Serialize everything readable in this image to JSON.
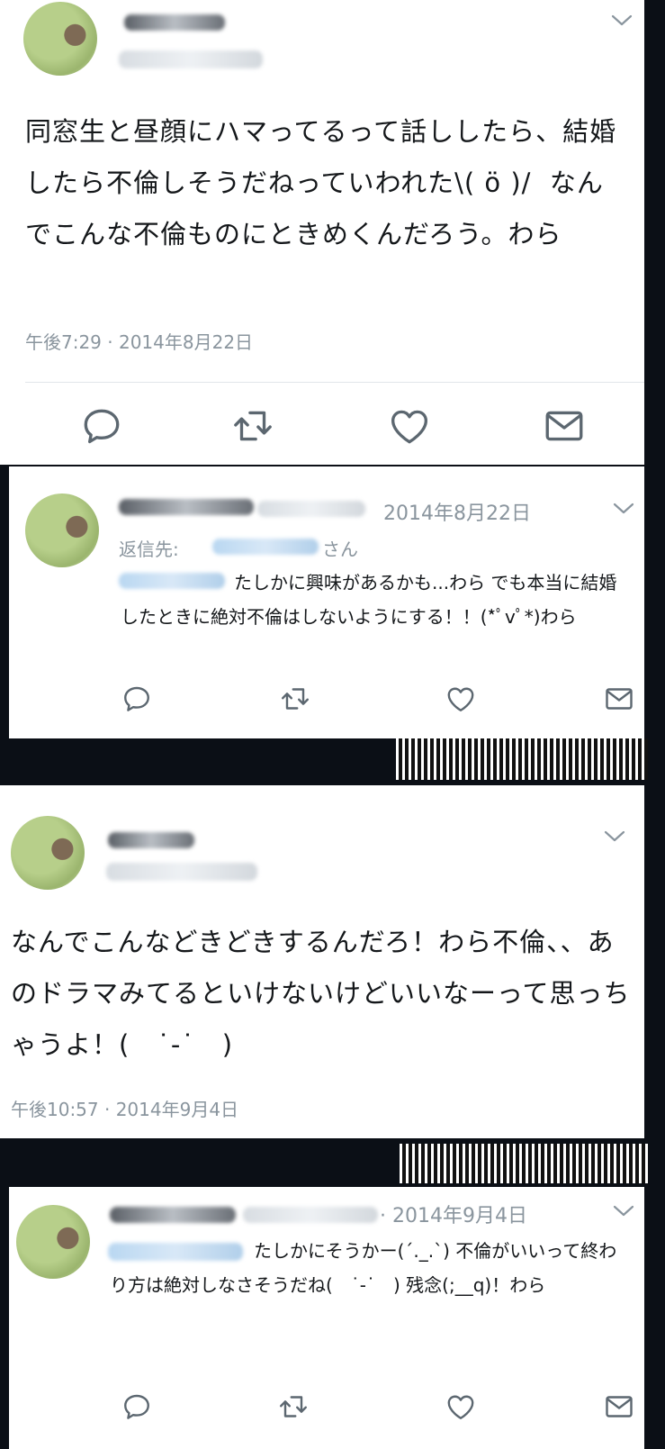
{
  "tweet1": {
    "text": "同窓生と昼顔にハマってるって話ししたら、結婚したら不倫しそうだねっていわれた\\( ö )/  なんでこんな不倫ものにときめくんだろう。わら",
    "timestamp": "午後7:29 · 2014年8月22日"
  },
  "reply1": {
    "date": "2014年8月22日",
    "reply_to_prefix": "返信先:",
    "reply_to_suffix": "さん",
    "text": "たしかに興味があるかも...わら でも本当に結婚したときに絶対不倫はしないようにする！！(*ﾟvﾟ*)わら"
  },
  "tweet2": {
    "text": "なんでこんなどきどきするんだろ！わら不倫、、あのドラマみてるといけないけどいいなーって思っちゃうよ！(　˙-˙　)",
    "timestamp": "午後10:57 · 2014年9月4日"
  },
  "reply2": {
    "date": "· 2014年9月4日",
    "text": "たしかにそうかー(´._.`) 不倫がいいって終わり方は絶対しなさそうだね(　˙-˙　) 残念(;__q)！わら"
  },
  "icons": [
    "reply-icon",
    "retweet-icon",
    "like-icon",
    "message-icon",
    "chevron-down-icon"
  ],
  "colors": {
    "meta": "#8a959e",
    "text": "#14171a",
    "link_blur": "#b9d7f1",
    "background": "#0b0f16"
  }
}
